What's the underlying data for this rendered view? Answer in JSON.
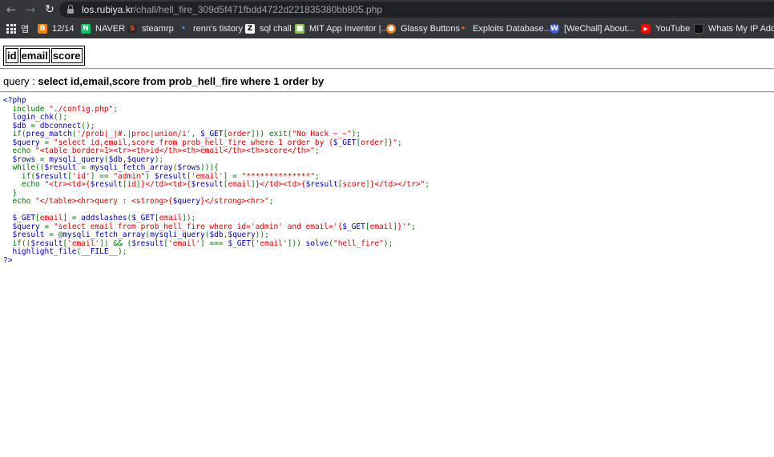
{
  "browser": {
    "url_host": "los.rubiya.kr",
    "url_path": "/chall/hell_fire_309d5f471fbdd4722d221835380bb805.php",
    "bookmarks": [
      {
        "label": "앱",
        "icon": "apps-grid-icon",
        "color": "#e8eaed"
      },
      {
        "label": "12/14",
        "icon": "blogger-icon",
        "color": "#f57d00"
      },
      {
        "label": "NAVER",
        "icon": "naver-icon",
        "color": "#03c75a"
      },
      {
        "label": "steamrp",
        "icon": "steam-icon",
        "color": "#c0392b"
      },
      {
        "label": "renn's tistory",
        "icon": "tistory-icon",
        "color": "#4a90e2"
      },
      {
        "label": "sql chall",
        "icon": "z-icon",
        "color": "#ffffff"
      },
      {
        "label": "MIT App Inventor |...",
        "icon": "app-inventor-icon",
        "color": "#8bc34a"
      },
      {
        "label": "Glassy Buttons",
        "icon": "glassy-icon",
        "color": "#e67e22"
      },
      {
        "label": "Exploits Database...",
        "icon": "exploit-db-icon",
        "color": "#e05a2b"
      },
      {
        "label": "[WeChall] About...",
        "icon": "wechall-icon",
        "color": "#3b5bdb"
      },
      {
        "label": "YouTube",
        "icon": "youtube-icon",
        "color": "#ff0000"
      },
      {
        "label": "Whats My IP Addr...",
        "icon": "ip-icon",
        "color": "#555555"
      }
    ]
  },
  "table": {
    "headers": [
      "id",
      "email",
      "score"
    ]
  },
  "query": {
    "prefix": "query : ",
    "sql": "select id,email,score from prob_hell_fire where 1 order by"
  },
  "source_lines": [
    [
      {
        "t": "<?php",
        "c": "d"
      }
    ],
    [
      {
        "t": "  include ",
        "c": "k"
      },
      {
        "t": "\"./config.php\"",
        "c": "s"
      },
      {
        "t": ";",
        "c": "k"
      }
    ],
    [
      {
        "t": "  login_chk",
        "c": "d"
      },
      {
        "t": "();",
        "c": "k"
      }
    ],
    [
      {
        "t": "  $db ",
        "c": "d"
      },
      {
        "t": "= ",
        "c": "k"
      },
      {
        "t": "dbconnect",
        "c": "d"
      },
      {
        "t": "();",
        "c": "k"
      }
    ],
    [
      {
        "t": "  if(",
        "c": "k"
      },
      {
        "t": "preg_match",
        "c": "d"
      },
      {
        "t": "(",
        "c": "k"
      },
      {
        "t": "'/prob|_|#.|proc|union/i'",
        "c": "s"
      },
      {
        "t": ", ",
        "c": "k"
      },
      {
        "t": "$_GET",
        "c": "d"
      },
      {
        "t": "[",
        "c": "k"
      },
      {
        "t": "order",
        "c": "s"
      },
      {
        "t": "])) exit(",
        "c": "k"
      },
      {
        "t": "\"No Hack ~_~\"",
        "c": "s"
      },
      {
        "t": ");",
        "c": "k"
      }
    ],
    [
      {
        "t": "  $query ",
        "c": "d"
      },
      {
        "t": "= ",
        "c": "k"
      },
      {
        "t": "\"select id,email,score from prob_hell_fire where 1 order by {",
        "c": "s"
      },
      {
        "t": "$_GET",
        "c": "d"
      },
      {
        "t": "[",
        "c": "k"
      },
      {
        "t": "order",
        "c": "s"
      },
      {
        "t": "]",
        "c": "k"
      },
      {
        "t": "}\"",
        "c": "s"
      },
      {
        "t": ";",
        "c": "k"
      }
    ],
    [
      {
        "t": "  echo ",
        "c": "k"
      },
      {
        "t": "\"<table border=1><tr><th>id</th><th>email</th><th>score</th>\"",
        "c": "s"
      },
      {
        "t": ";",
        "c": "k"
      }
    ],
    [
      {
        "t": "  $rows ",
        "c": "d"
      },
      {
        "t": "= ",
        "c": "k"
      },
      {
        "t": "mysqli_query",
        "c": "d"
      },
      {
        "t": "(",
        "c": "k"
      },
      {
        "t": "$db",
        "c": "d"
      },
      {
        "t": ",",
        "c": "k"
      },
      {
        "t": "$query",
        "c": "d"
      },
      {
        "t": ");",
        "c": "k"
      }
    ],
    [
      {
        "t": "  while((",
        "c": "k"
      },
      {
        "t": "$result ",
        "c": "d"
      },
      {
        "t": "= ",
        "c": "k"
      },
      {
        "t": "mysqli_fetch_array",
        "c": "d"
      },
      {
        "t": "(",
        "c": "k"
      },
      {
        "t": "$rows",
        "c": "d"
      },
      {
        "t": "))){",
        "c": "k"
      }
    ],
    [
      {
        "t": "    if(",
        "c": "k"
      },
      {
        "t": "$result",
        "c": "d"
      },
      {
        "t": "[",
        "c": "k"
      },
      {
        "t": "'id'",
        "c": "s"
      },
      {
        "t": "] == ",
        "c": "k"
      },
      {
        "t": "\"admin\"",
        "c": "s"
      },
      {
        "t": ") ",
        "c": "k"
      },
      {
        "t": "$result",
        "c": "d"
      },
      {
        "t": "[",
        "c": "k"
      },
      {
        "t": "'email'",
        "c": "s"
      },
      {
        "t": "] = ",
        "c": "k"
      },
      {
        "t": "\"**************\"",
        "c": "s"
      },
      {
        "t": ";",
        "c": "k"
      }
    ],
    [
      {
        "t": "    echo ",
        "c": "k"
      },
      {
        "t": "\"<tr><td>{",
        "c": "s"
      },
      {
        "t": "$result",
        "c": "d"
      },
      {
        "t": "[",
        "c": "k"
      },
      {
        "t": "id",
        "c": "s"
      },
      {
        "t": "]",
        "c": "k"
      },
      {
        "t": "}</td><td>{",
        "c": "s"
      },
      {
        "t": "$result",
        "c": "d"
      },
      {
        "t": "[",
        "c": "k"
      },
      {
        "t": "email",
        "c": "s"
      },
      {
        "t": "]",
        "c": "k"
      },
      {
        "t": "}</td><td>{",
        "c": "s"
      },
      {
        "t": "$result",
        "c": "d"
      },
      {
        "t": "[",
        "c": "k"
      },
      {
        "t": "score",
        "c": "s"
      },
      {
        "t": "]",
        "c": "k"
      },
      {
        "t": "}</td></tr>\"",
        "c": "s"
      },
      {
        "t": ";",
        "c": "k"
      }
    ],
    [
      {
        "t": "  }",
        "c": "k"
      }
    ],
    [
      {
        "t": "  echo ",
        "c": "k"
      },
      {
        "t": "\"</table><hr>query : <strong>{",
        "c": "s"
      },
      {
        "t": "$query",
        "c": "d"
      },
      {
        "t": "}</strong><hr>\"",
        "c": "s"
      },
      {
        "t": ";",
        "c": "k"
      }
    ],
    [
      {
        "t": "",
        "c": "k"
      }
    ],
    [
      {
        "t": "  $_GET",
        "c": "d"
      },
      {
        "t": "[",
        "c": "k"
      },
      {
        "t": "email",
        "c": "s"
      },
      {
        "t": "] = ",
        "c": "k"
      },
      {
        "t": "addslashes",
        "c": "d"
      },
      {
        "t": "(",
        "c": "k"
      },
      {
        "t": "$_GET",
        "c": "d"
      },
      {
        "t": "[",
        "c": "k"
      },
      {
        "t": "email",
        "c": "s"
      },
      {
        "t": "]);",
        "c": "k"
      }
    ],
    [
      {
        "t": "  $query ",
        "c": "d"
      },
      {
        "t": "= ",
        "c": "k"
      },
      {
        "t": "\"select email from prob_hell_fire where id='admin' and email='{",
        "c": "s"
      },
      {
        "t": "$_GET",
        "c": "d"
      },
      {
        "t": "[",
        "c": "k"
      },
      {
        "t": "email",
        "c": "s"
      },
      {
        "t": "]",
        "c": "k"
      },
      {
        "t": "}'\"",
        "c": "s"
      },
      {
        "t": ";",
        "c": "k"
      }
    ],
    [
      {
        "t": "  $result ",
        "c": "d"
      },
      {
        "t": "= @",
        "c": "k"
      },
      {
        "t": "mysqli_fetch_array",
        "c": "d"
      },
      {
        "t": "(",
        "c": "k"
      },
      {
        "t": "mysqli_query",
        "c": "d"
      },
      {
        "t": "(",
        "c": "k"
      },
      {
        "t": "$db",
        "c": "d"
      },
      {
        "t": ",",
        "c": "k"
      },
      {
        "t": "$query",
        "c": "d"
      },
      {
        "t": "));",
        "c": "k"
      }
    ],
    [
      {
        "t": "  if((",
        "c": "k"
      },
      {
        "t": "$result",
        "c": "d"
      },
      {
        "t": "[",
        "c": "k"
      },
      {
        "t": "'email'",
        "c": "s"
      },
      {
        "t": "]) && (",
        "c": "k"
      },
      {
        "t": "$result",
        "c": "d"
      },
      {
        "t": "[",
        "c": "k"
      },
      {
        "t": "'email'",
        "c": "s"
      },
      {
        "t": "] === ",
        "c": "k"
      },
      {
        "t": "$_GET",
        "c": "d"
      },
      {
        "t": "[",
        "c": "k"
      },
      {
        "t": "'email'",
        "c": "s"
      },
      {
        "t": "])) ",
        "c": "k"
      },
      {
        "t": "solve",
        "c": "d"
      },
      {
        "t": "(",
        "c": "k"
      },
      {
        "t": "\"hell_fire\"",
        "c": "s"
      },
      {
        "t": ");",
        "c": "k"
      }
    ],
    [
      {
        "t": "  highlight_file",
        "c": "d"
      },
      {
        "t": "(",
        "c": "k"
      },
      {
        "t": "__FILE__",
        "c": "d"
      },
      {
        "t": ");",
        "c": "k"
      }
    ],
    [
      {
        "t": "?>",
        "c": "d"
      }
    ]
  ]
}
